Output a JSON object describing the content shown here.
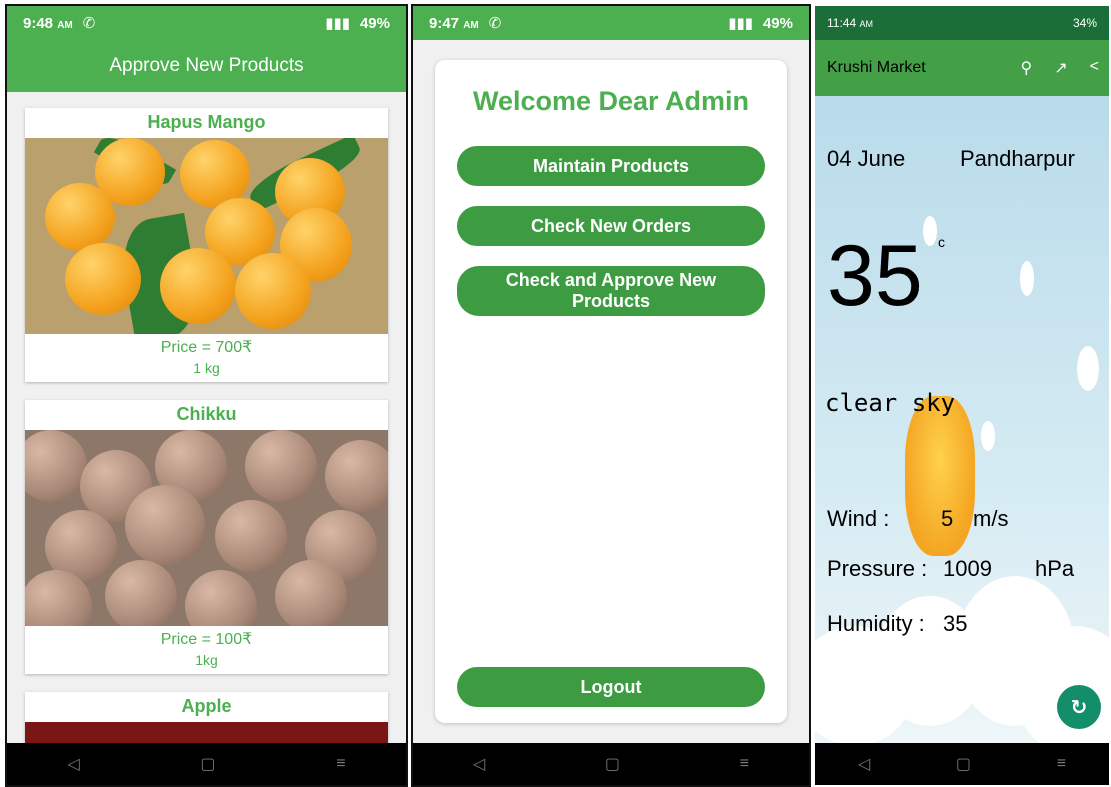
{
  "phone1": {
    "status": {
      "time": "9:48",
      "ampm": "AM",
      "battery": "49%"
    },
    "title": "Approve New Products",
    "products": [
      {
        "name": "Hapus Mango",
        "price": "Price = 700₹",
        "qty": "1 kg"
      },
      {
        "name": "Chikku",
        "price": "Price = 100₹",
        "qty": "1kg"
      },
      {
        "name": "Apple"
      }
    ]
  },
  "phone2": {
    "status": {
      "time": "9:47",
      "ampm": "AM",
      "battery": "49%"
    },
    "welcome": "Welcome Dear Admin",
    "buttons": {
      "maintain": "Maintain Products",
      "orders": "Check New Orders",
      "approve": "Check and Approve New Products",
      "logout": "Logout"
    }
  },
  "phone3": {
    "status": {
      "time": "11:44",
      "ampm": "AM",
      "battery": "34%"
    },
    "app_title": "Krushi Market",
    "date": "04 June",
    "city": "Pandharpur",
    "temp": "35",
    "temp_unit": "c",
    "description": "clear sky",
    "wind_label": "Wind :",
    "wind_value": "5",
    "wind_unit": "m/s",
    "pressure_label": "Pressure :",
    "pressure_value": "1009",
    "pressure_unit": "hPa",
    "humidity_label": "Humidity :",
    "humidity_value": "35"
  },
  "icons": {
    "nav_back": "◁",
    "nav_home": "▢",
    "nav_menu": "≡",
    "phone_call": "✆",
    "search": "⚲",
    "trend": "↗",
    "share": "<",
    "refresh": "↻"
  }
}
